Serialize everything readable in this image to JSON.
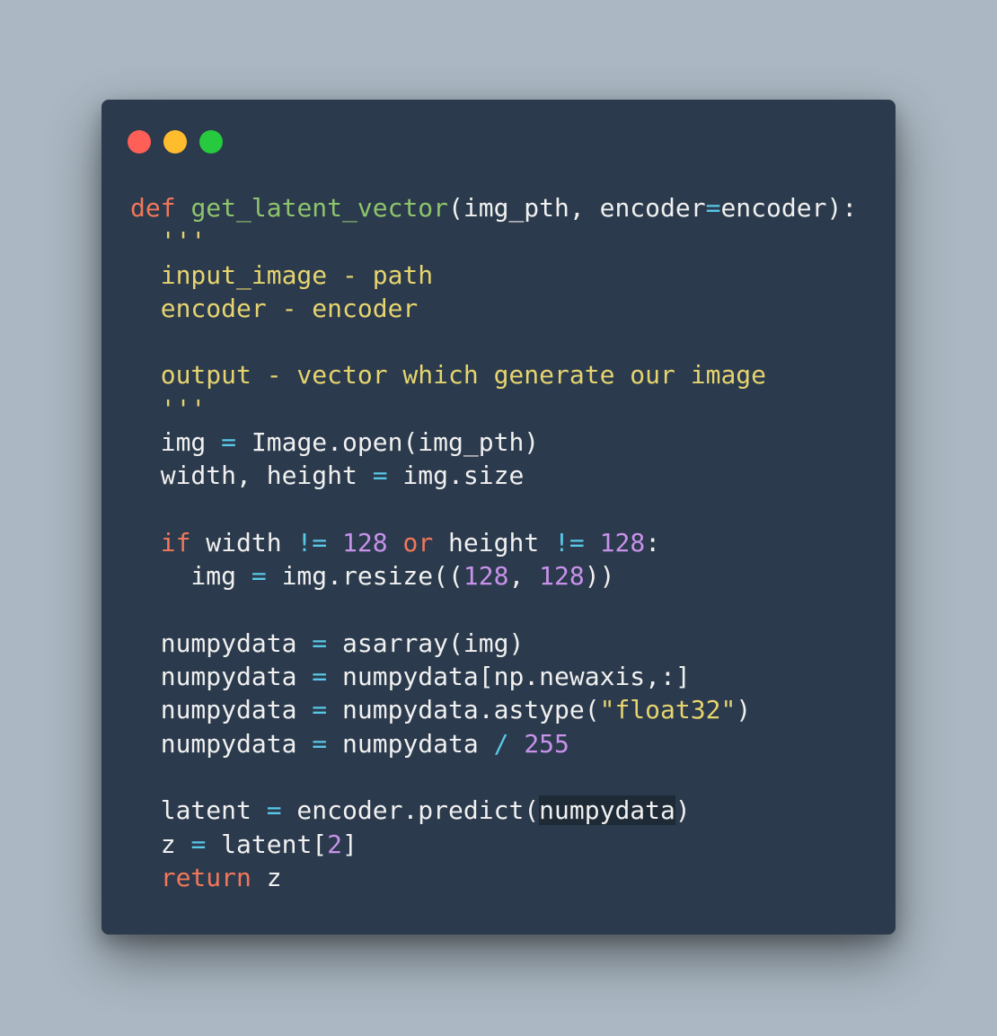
{
  "window": {
    "controls": [
      {
        "name": "close",
        "color": "#ff5f56"
      },
      {
        "name": "minimize",
        "color": "#ffbd2e"
      },
      {
        "name": "maximize",
        "color": "#27c93f"
      }
    ]
  },
  "code": {
    "lines": [
      [
        {
          "t": "def",
          "c": "kw"
        },
        {
          "t": " "
        },
        {
          "t": "get_latent_vector",
          "c": "fn"
        },
        {
          "t": "(img_pth, encoder"
        },
        {
          "t": "=",
          "c": "op"
        },
        {
          "t": "encoder):"
        }
      ],
      [
        {
          "t": "  '''",
          "c": "doc"
        }
      ],
      [
        {
          "t": "  input_image - path",
          "c": "doc"
        }
      ],
      [
        {
          "t": "  encoder - encoder",
          "c": "doc"
        }
      ],
      [],
      [
        {
          "t": "  output - vector which generate our image",
          "c": "doc"
        }
      ],
      [
        {
          "t": "  '''",
          "c": "doc"
        }
      ],
      [
        {
          "t": "  img "
        },
        {
          "t": "=",
          "c": "op"
        },
        {
          "t": " Image.open(img_pth)"
        }
      ],
      [
        {
          "t": "  width, height "
        },
        {
          "t": "=",
          "c": "op"
        },
        {
          "t": " img.size"
        }
      ],
      [],
      [
        {
          "t": "  "
        },
        {
          "t": "if",
          "c": "kw"
        },
        {
          "t": " width "
        },
        {
          "t": "!=",
          "c": "op"
        },
        {
          "t": " "
        },
        {
          "t": "128",
          "c": "num"
        },
        {
          "t": " "
        },
        {
          "t": "or",
          "c": "kw"
        },
        {
          "t": " height "
        },
        {
          "t": "!=",
          "c": "op"
        },
        {
          "t": " "
        },
        {
          "t": "128",
          "c": "num"
        },
        {
          "t": ":"
        }
      ],
      [
        {
          "t": "    img "
        },
        {
          "t": "=",
          "c": "op"
        },
        {
          "t": " img.resize(("
        },
        {
          "t": "128",
          "c": "num"
        },
        {
          "t": ", "
        },
        {
          "t": "128",
          "c": "num"
        },
        {
          "t": "))"
        }
      ],
      [],
      [
        {
          "t": "  numpydata "
        },
        {
          "t": "=",
          "c": "op"
        },
        {
          "t": " asarray(img)"
        }
      ],
      [
        {
          "t": "  numpydata "
        },
        {
          "t": "=",
          "c": "op"
        },
        {
          "t": " numpydata[np.newaxis,:]"
        }
      ],
      [
        {
          "t": "  numpydata "
        },
        {
          "t": "=",
          "c": "op"
        },
        {
          "t": " numpydata.astype("
        },
        {
          "t": "\"float32\"",
          "c": "str"
        },
        {
          "t": ")"
        }
      ],
      [
        {
          "t": "  numpydata "
        },
        {
          "t": "=",
          "c": "op"
        },
        {
          "t": " numpydata "
        },
        {
          "t": "/",
          "c": "op"
        },
        {
          "t": " "
        },
        {
          "t": "255",
          "c": "num"
        }
      ],
      [],
      [
        {
          "t": "  latent "
        },
        {
          "t": "=",
          "c": "op"
        },
        {
          "t": " encoder.predict("
        },
        {
          "t": "numpydata",
          "c": "hl"
        },
        {
          "t": ")"
        }
      ],
      [
        {
          "t": "  z "
        },
        {
          "t": "=",
          "c": "op"
        },
        {
          "t": " latent["
        },
        {
          "t": "2",
          "c": "num"
        },
        {
          "t": "]"
        }
      ],
      [
        {
          "t": "  "
        },
        {
          "t": "return",
          "c": "kw"
        },
        {
          "t": " z"
        }
      ]
    ]
  }
}
